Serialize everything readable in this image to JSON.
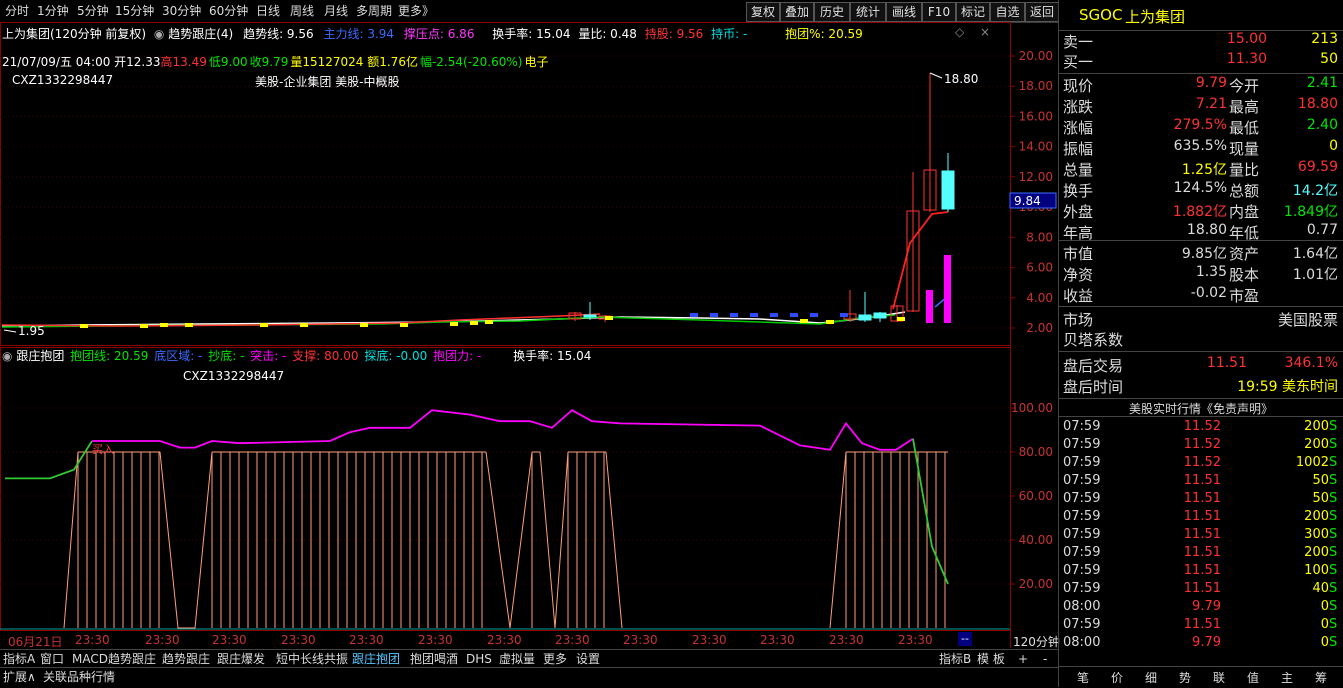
{
  "toolbar": {
    "periods": [
      "分时",
      "1分钟",
      "5分钟",
      "15分钟",
      "30分钟",
      "60分钟",
      "日线",
      "周线",
      "月线",
      "多周期",
      "更多》"
    ],
    "buttons": [
      "复权",
      "叠加",
      "历史",
      "统计",
      "画线",
      "F10",
      "标记",
      "自选",
      "返回"
    ]
  },
  "header": {
    "stock_title": "上为集团(120分钟 前复权)",
    "indicator_name": "趋势跟庄(4)",
    "trend_line_label": "趋势线: 9.56",
    "main_force_label": "主力线: 3.94",
    "pressure_label": "撑压点: 6.86",
    "turnover_label": "换手率: 15.04",
    "volume_ratio_label": "量比: 0.48",
    "holding_label": "持股: 9.56",
    "holding_coin_label": "持币: -",
    "hug_pct_label": "抱团%: 20.59",
    "bar_info": "21/07/09/五 04:00 开12.33",
    "bar_high": "高13.49",
    "bar_low": "低9.00",
    "bar_close": "收9.79",
    "bar_vol": "量15127024 额1.76亿",
    "bar_chg": "幅-2.54(-20.60%)",
    "bar_sector": "电子",
    "code_line": "CXZ1332298447",
    "sector_line": "美股-企业集团 美股-中概股"
  },
  "main_chart": {
    "y_ticks": [
      "20.00",
      "18.00",
      "16.00",
      "14.00",
      "12.00",
      "10.00",
      "8.00",
      "6.00",
      "4.00",
      "2.00"
    ],
    "max_label": "18.80",
    "min_label": "1.95",
    "last_price_tag": "9.84"
  },
  "sub_chart": {
    "title": "跟庄抱团",
    "hug_line_label": "抱团线: 20.59",
    "bottom_zone_label": "底区域: -",
    "bottom_fish_label": "抄底: -",
    "breakout_label": "突击: -",
    "support_label": "支撑: 80.00",
    "probe_label": "探底: -0.00",
    "hug_force_label": "抱团力: -",
    "turnover_label": "换手率: 15.04",
    "code_line": "CXZ1332298447",
    "buy_mark": "买入",
    "y_ticks": [
      "100.00",
      "80.00",
      "60.00",
      "40.00",
      "20.00"
    ]
  },
  "time_axis": {
    "labels": [
      "06月21日",
      "23:30",
      "23:30",
      "23:30",
      "23:30",
      "23:30",
      "23:30",
      "23:30",
      "23:30",
      "23:30",
      "23:30",
      "23:30",
      "23:30",
      "23:30"
    ],
    "period": "120分钟",
    "corner": "--"
  },
  "bottom_tabs": [
    "指标A",
    "窗口",
    "MACD趋势跟庄",
    "趋势跟庄",
    "跟庄爆发",
    "短中长线共振",
    "跟庄抱团",
    "抱团喝酒",
    "DHS",
    "虚拟量",
    "更多",
    "设置"
  ],
  "bottom_right_tabs": [
    "指标B",
    "模 板",
    "+",
    "-"
  ],
  "bottom_row2": [
    "扩展∧",
    "关联品种行情"
  ],
  "quote": {
    "symbol": "SGOC",
    "name": "上为集团",
    "ask_label": "卖一",
    "ask_price": "15.00",
    "ask_vol": "213",
    "bid_label": "买一",
    "bid_price": "11.30",
    "bid_vol": "50",
    "grid": [
      [
        "现价",
        "9.79",
        "今开",
        "2.41"
      ],
      [
        "涨跌",
        "7.21",
        "最高",
        "18.80"
      ],
      [
        "涨幅",
        "279.5%",
        "最低",
        "2.40"
      ],
      [
        "振幅",
        "635.5%",
        "现量",
        "0"
      ],
      [
        "总量",
        "1.25亿",
        "量比",
        "69.59"
      ],
      [
        "换手",
        "124.5%",
        "总额",
        "14.2亿"
      ],
      [
        "外盘",
        "1.882亿",
        "内盘",
        "1.849亿"
      ],
      [
        "年高",
        "18.80",
        "年低",
        "0.77"
      ]
    ],
    "grid2": [
      [
        "市值",
        "9.85亿",
        "资产",
        "1.64亿"
      ],
      [
        "净资",
        "1.35",
        "股本",
        "1.01亿"
      ],
      [
        "收益",
        "-0.02",
        "市盈",
        ""
      ]
    ],
    "market_label": "市场",
    "market_value": "美国股票",
    "beta_label": "贝塔系数",
    "after_label": "盘后交易",
    "after_price": "11.51",
    "after_pct": "346.1%",
    "after_time_label": "盘后时间",
    "after_time": "19:59 美东时间",
    "realtime_title": "美股实时行情《免责声明》",
    "ticks": [
      [
        "07:59",
        "11.52",
        "200",
        "S"
      ],
      [
        "07:59",
        "11.52",
        "200",
        "S"
      ],
      [
        "07:59",
        "11.52",
        "1002",
        "S"
      ],
      [
        "07:59",
        "11.51",
        "50",
        "S"
      ],
      [
        "07:59",
        "11.51",
        "50",
        "S"
      ],
      [
        "07:59",
        "11.51",
        "200",
        "S"
      ],
      [
        "07:59",
        "11.51",
        "300",
        "S"
      ],
      [
        "07:59",
        "11.51",
        "200",
        "S"
      ],
      [
        "07:59",
        "11.51",
        "100",
        "S"
      ],
      [
        "07:59",
        "11.51",
        "40",
        "S"
      ],
      [
        "08:00",
        "9.79",
        "0",
        "S"
      ],
      [
        "07:59",
        "11.51",
        "0",
        "S"
      ],
      [
        "08:00",
        "9.79",
        "0",
        "S"
      ]
    ],
    "bottom_tabs": [
      "笔",
      "价",
      "细",
      "势",
      "联",
      "值",
      "主",
      "筹"
    ]
  },
  "colors": {
    "red": "#ff3232",
    "green": "#00e600",
    "yellow": "#ffff00",
    "white": "#ffffff",
    "magenta": "#ff00ff",
    "cyan": "#54ffff",
    "grid": "#8b0000"
  }
}
